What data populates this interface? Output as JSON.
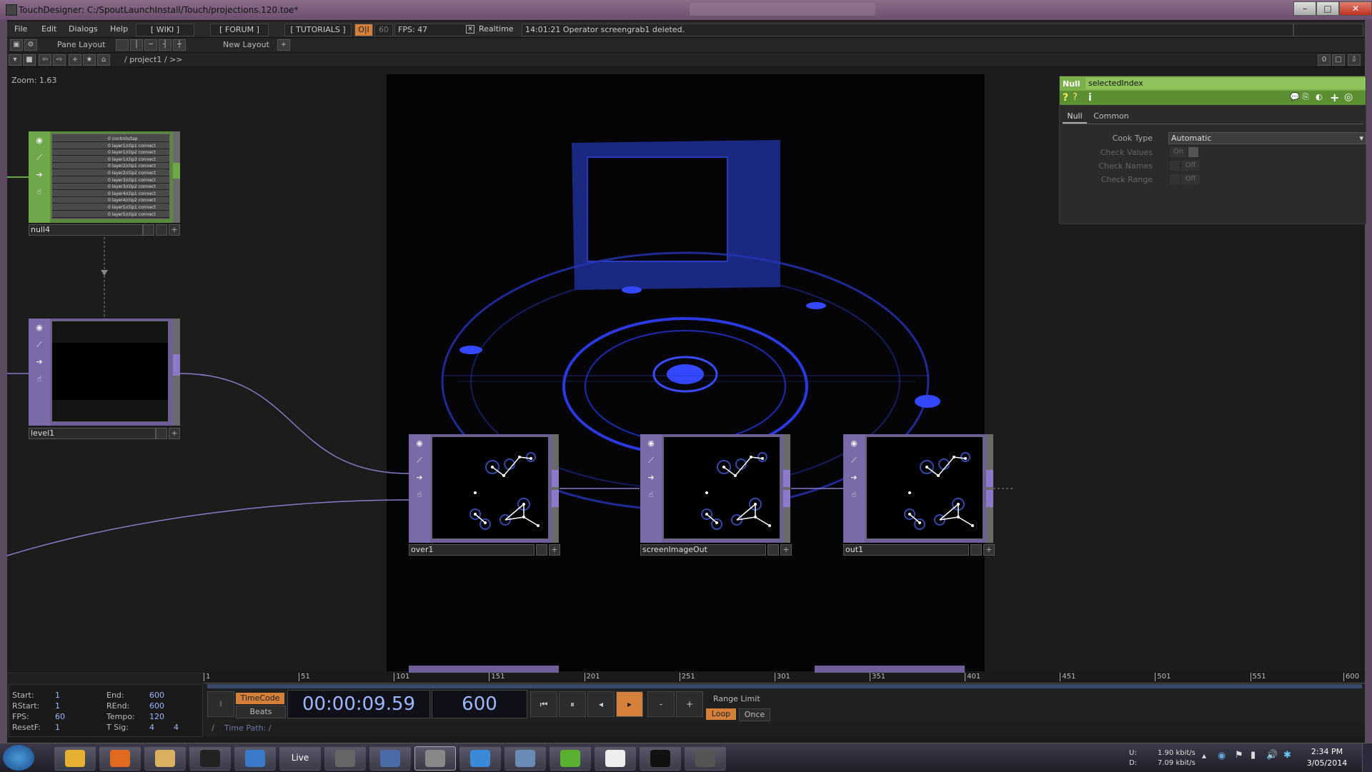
{
  "window": {
    "title": "TouchDesigner: C:/SpoutLaunchInstall/Touch/projections.120.toe*",
    "controls": [
      "–",
      "□",
      "✕"
    ]
  },
  "menu": {
    "items": [
      "File",
      "Edit",
      "Dialogs",
      "Help"
    ],
    "wiki": "[ WIKI ]",
    "forum": "[ FORUM ]",
    "tutorials": "[ TUTORIALS ]",
    "oi": "O|I",
    "sixty": "60",
    "fps": "FPS: 47",
    "realtime_label": "Realtime",
    "status_message": "14:01:21 Operator screengrab1 deleted."
  },
  "toolbar": {
    "pane_layout": "Pane Layout",
    "new_layout": "New Layout",
    "plus": "+"
  },
  "pathbar": {
    "path": "/ project1 / >>",
    "right_num": "0"
  },
  "network": {
    "zoom": "Zoom: 1.63",
    "nodes": {
      "null4": "null4",
      "level1": "level1",
      "over1": "over1",
      "screenImageOut": "screenImageOut",
      "out1": "out1"
    },
    "table_rows": [
      "0 controls/tap",
      "0 layer1/clip1 connect",
      "0 layer1/clip2 connect",
      "0 layer1/clip3 connect",
      "0 layer2/clip1 connect",
      "0 layer2/clip2 connect",
      "0 layer3/clip1 connect",
      "0 layer3/clip2 connect",
      "0 layer4/clip1 connect",
      "0 layer4/clip2 connect",
      "0 layer5/clip1 connect",
      "0 layer5/clip2 connect"
    ]
  },
  "params": {
    "op_type": "Null",
    "op_name": "selectedIndex",
    "tabs": [
      "Null",
      "Common"
    ],
    "rows": [
      {
        "label": "Cook Type",
        "value": "Automatic"
      },
      {
        "label": "Check Values",
        "value": "On"
      },
      {
        "label": "Check Names",
        "value": "Off"
      },
      {
        "label": "Check Range",
        "value": "Off"
      }
    ]
  },
  "timeline": {
    "ticks": [
      "1",
      "51",
      "101",
      "151",
      "201",
      "251",
      "301",
      "351",
      "401",
      "451",
      "501",
      "551",
      "600"
    ],
    "info_labels": [
      "Start:",
      "RStart:",
      "FPS:",
      "ResetF:"
    ],
    "info_values": [
      "1",
      "1",
      "60",
      "1"
    ],
    "info_labels2": [
      "End:",
      "REnd:",
      "Tempo:",
      "T Sig:"
    ],
    "info_values2": [
      "600",
      "600",
      "120",
      "4"
    ],
    "tsig2": "4",
    "timecode_label": "TimeCode",
    "beats_label": "Beats",
    "timecode": "00:00:09.59",
    "frame": "600",
    "range_limit": "Range Limit",
    "loop": "Loop",
    "once": "Once",
    "time_path": "Time Path: /",
    "slash": "/",
    "minus": "-",
    "plus": "+"
  },
  "taskbar": {
    "apps": [
      "Chrome",
      "Firefox",
      "Explorer",
      "Terminal",
      "Media",
      "Live",
      "App",
      "Folder",
      "TouchDesigner",
      "Ableton",
      "Calculator",
      "Processing4",
      "OpenGL",
      "Pd",
      "App2"
    ],
    "live_label": "Live",
    "net_up_label": "U:",
    "net_down_label": "D:",
    "net_up": "1.90 kbit/s",
    "net_down": "7.09 kbit/s",
    "time": "2:34 PM",
    "date": "3/05/2014"
  },
  "colors": {
    "node_top": "#6e5f9a",
    "dat_node": "#5a8a3c",
    "param_header": "#7bb04a",
    "play_active": "#d4803a",
    "timecode_text": "#9db8ff"
  }
}
